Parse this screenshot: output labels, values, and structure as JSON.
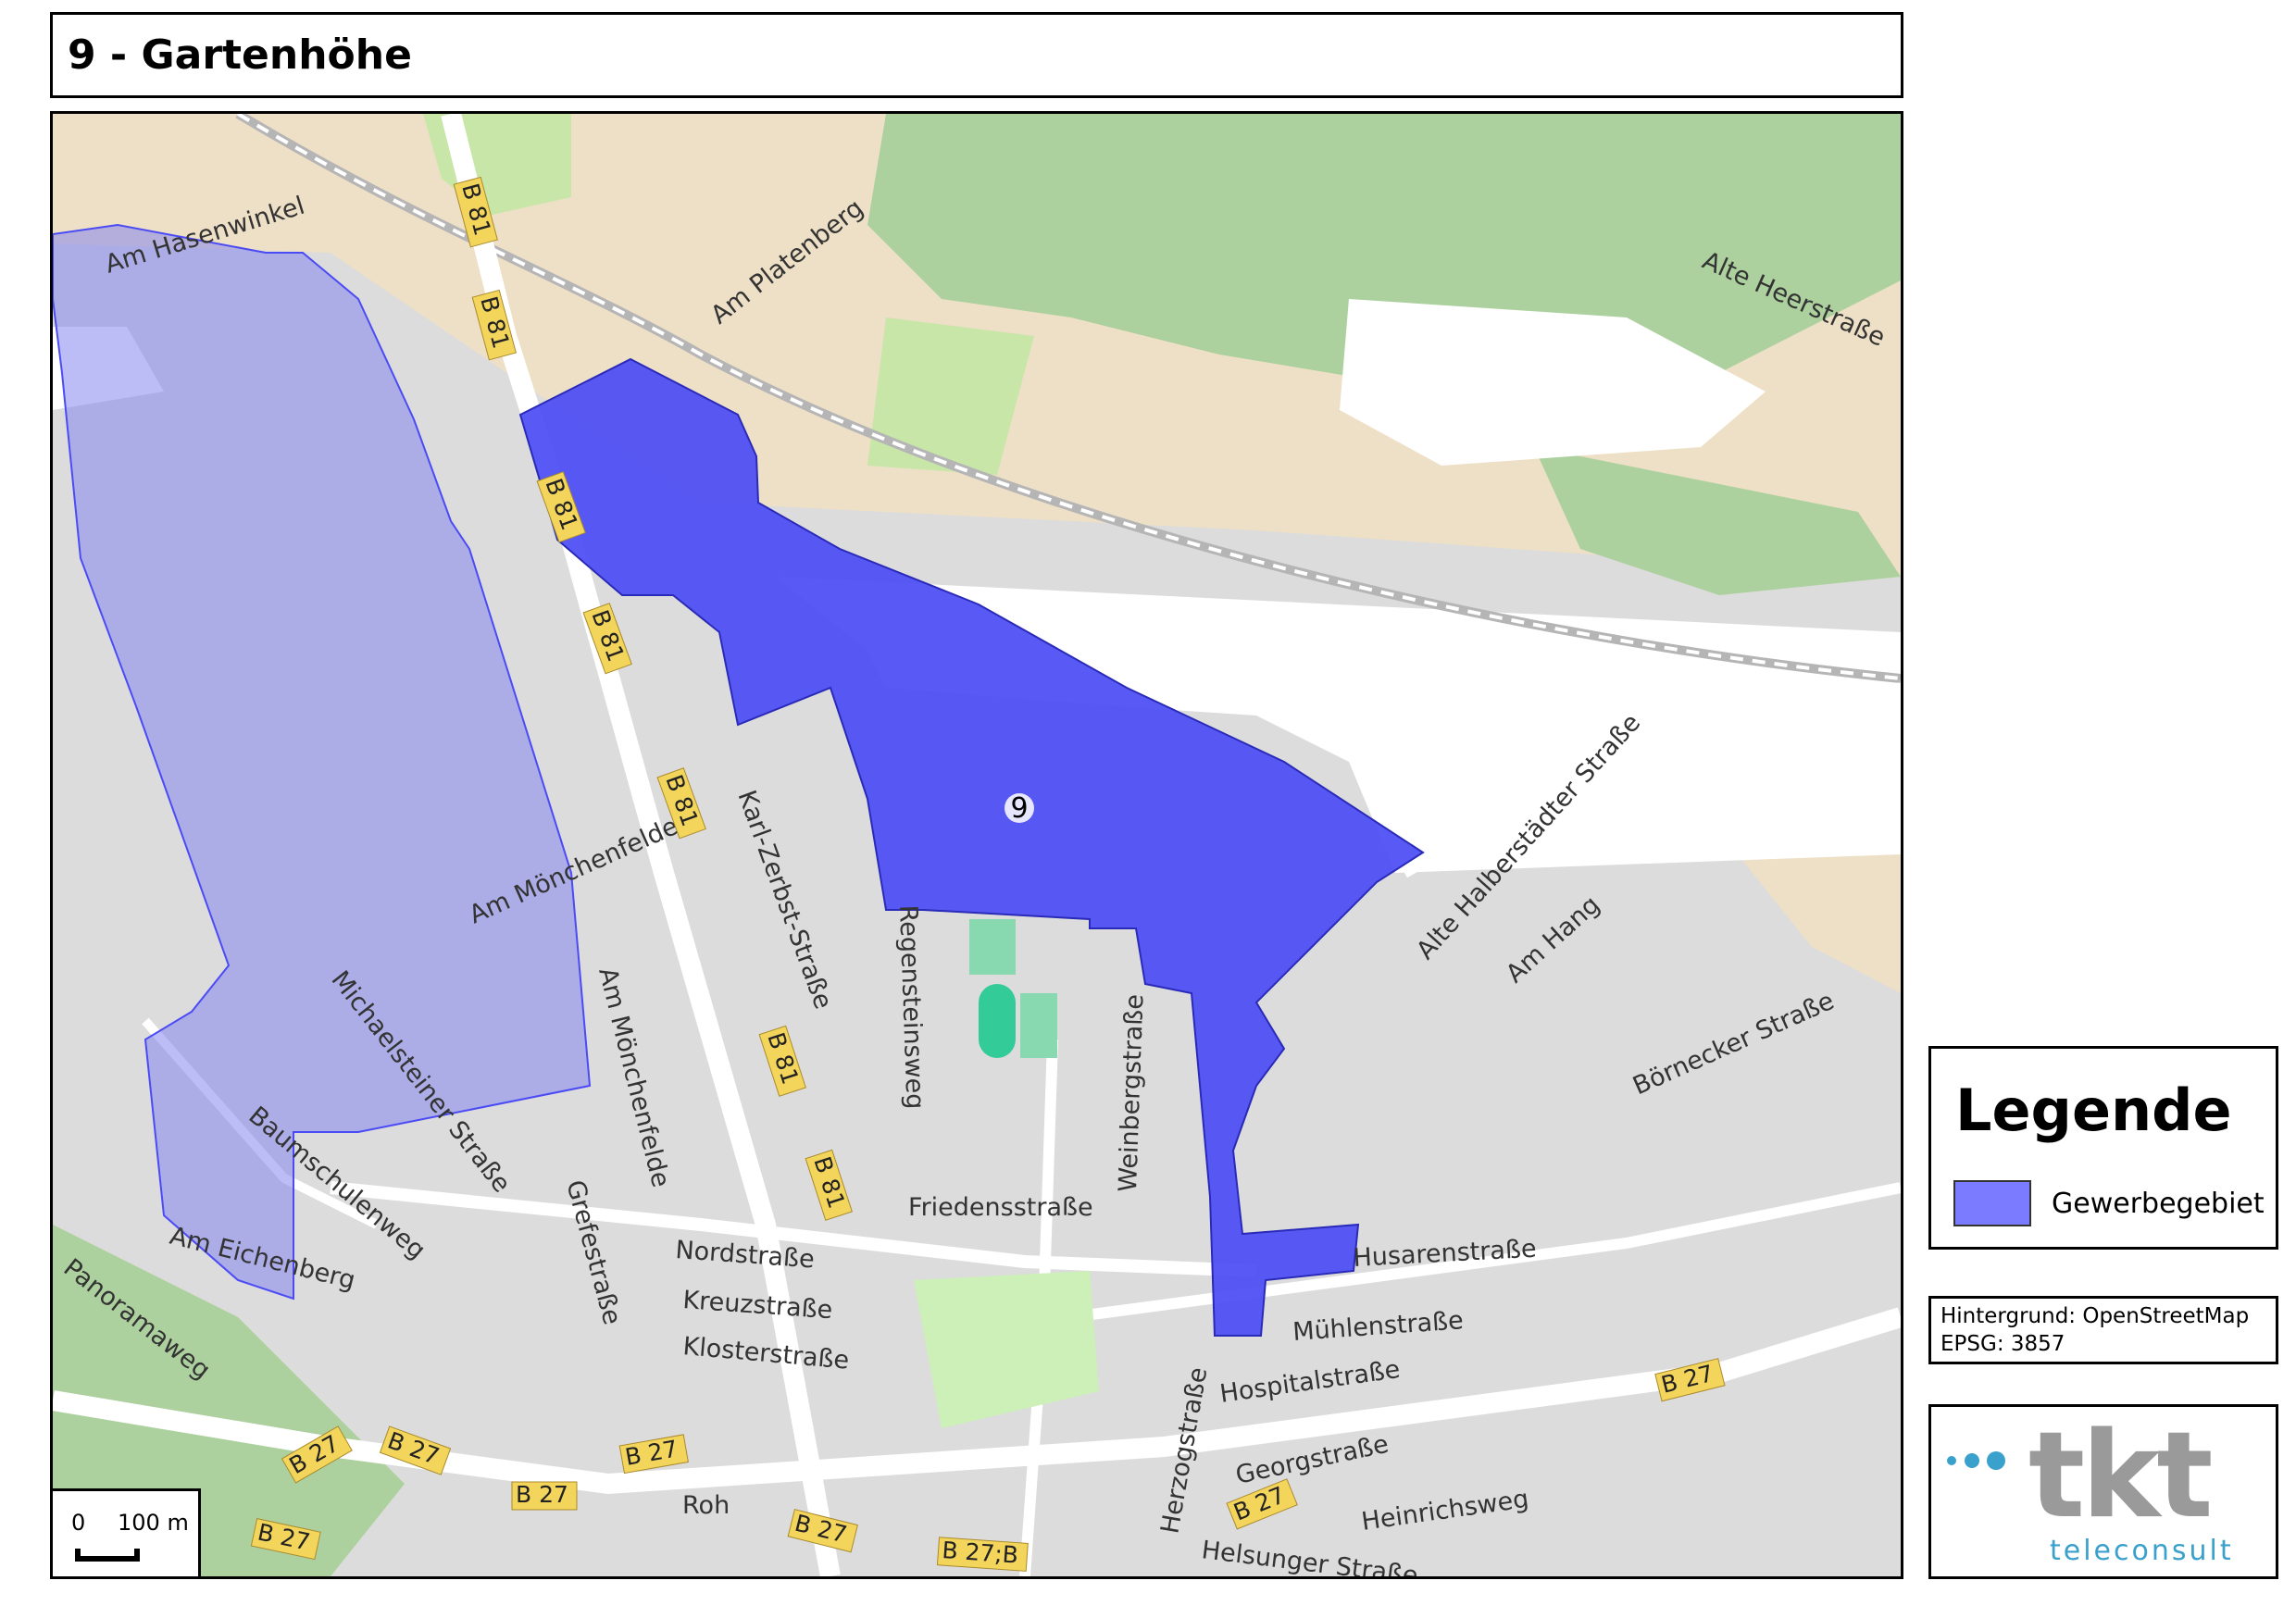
{
  "title": "9 - Gartenhöhe",
  "map": {
    "area_label": "9",
    "street_labels": [
      "Am Hasenwinkel",
      "Am Platenberg",
      "Alte Heerstraße",
      "Karl-Zerbst-Straße",
      "Am Mönchenfelde",
      "Am Mönchenfelde",
      "Regensteinsweg",
      "Weinbergstraße",
      "Alte Halberstädter Straße",
      "Am Hang",
      "Börnecker Straße",
      "Michaelsteiner Straße",
      "Baumschulenweg",
      "Grefestraße",
      "Friedensstraße",
      "Nordstraße",
      "Kreuzstraße",
      "Klosterstraße",
      "Husarenstraße",
      "Mühlenstraße",
      "Hospitalstraße",
      "Georgstraße",
      "Heinrichsweg",
      "Helsunger Straße",
      "Herzogstraße",
      "Am Eichenberg",
      "Panoramaweg",
      "Roh"
    ],
    "road_shields": [
      "B 81",
      "B 81",
      "B 81",
      "B 81",
      "B 81",
      "B 81",
      "B 81",
      "B 27",
      "B 27",
      "B 27",
      "B 27",
      "B 27",
      "B 27",
      "B 27",
      "B 27",
      "B 27;B"
    ],
    "colors": {
      "area_primary": "#4b4bf5",
      "area_secondary": "#8585f0",
      "forest": "#add19e",
      "farmland": "#eee0c6",
      "residential": "#dcdcdc",
      "road": "#ffffff"
    }
  },
  "scale": {
    "zero": "0",
    "distance": "100 m"
  },
  "legend": {
    "title": "Legende",
    "items": [
      {
        "label": "Gewerbegebiet",
        "color": "#7b7bff"
      }
    ]
  },
  "source": {
    "background": "Hintergrund: OpenStreetMap",
    "epsg": "EPSG: 3857"
  },
  "logo": {
    "name": "tkt",
    "subtitle": "teleconsult"
  }
}
